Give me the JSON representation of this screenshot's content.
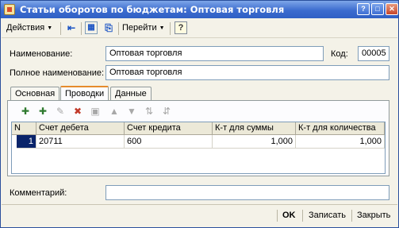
{
  "window": {
    "title": "Статьи оборотов по бюджетам: Оптовая торговля",
    "controls": {
      "help": "?",
      "maximize": "□",
      "close": "✕"
    }
  },
  "toolbar": {
    "actions_label": "Действия",
    "goto_label": "Перейти",
    "help_label": "?"
  },
  "form": {
    "name_label": "Наименование:",
    "name_value": "Оптовая торговля",
    "code_label": "Код:",
    "code_value": "00005",
    "full_name_label": "Полное наименование:",
    "full_name_value": "Оптовая торговля",
    "comment_label": "Комментарий:",
    "comment_value": ""
  },
  "tabs": [
    {
      "label": "Основная",
      "active": false
    },
    {
      "label": "Проводки",
      "active": true
    },
    {
      "label": "Данные",
      "active": false
    }
  ],
  "table": {
    "columns": [
      "N",
      "Счет дебета",
      "Счет кредита",
      "К-т для суммы",
      "К-т для количества"
    ],
    "rows": [
      {
        "n": "1",
        "debit": "20711",
        "credit": "600",
        "k_sum": "1,000",
        "k_qty": "1,000"
      }
    ]
  },
  "buttons": {
    "ok": "OK",
    "save": "Записать",
    "close": "Закрыть"
  }
}
